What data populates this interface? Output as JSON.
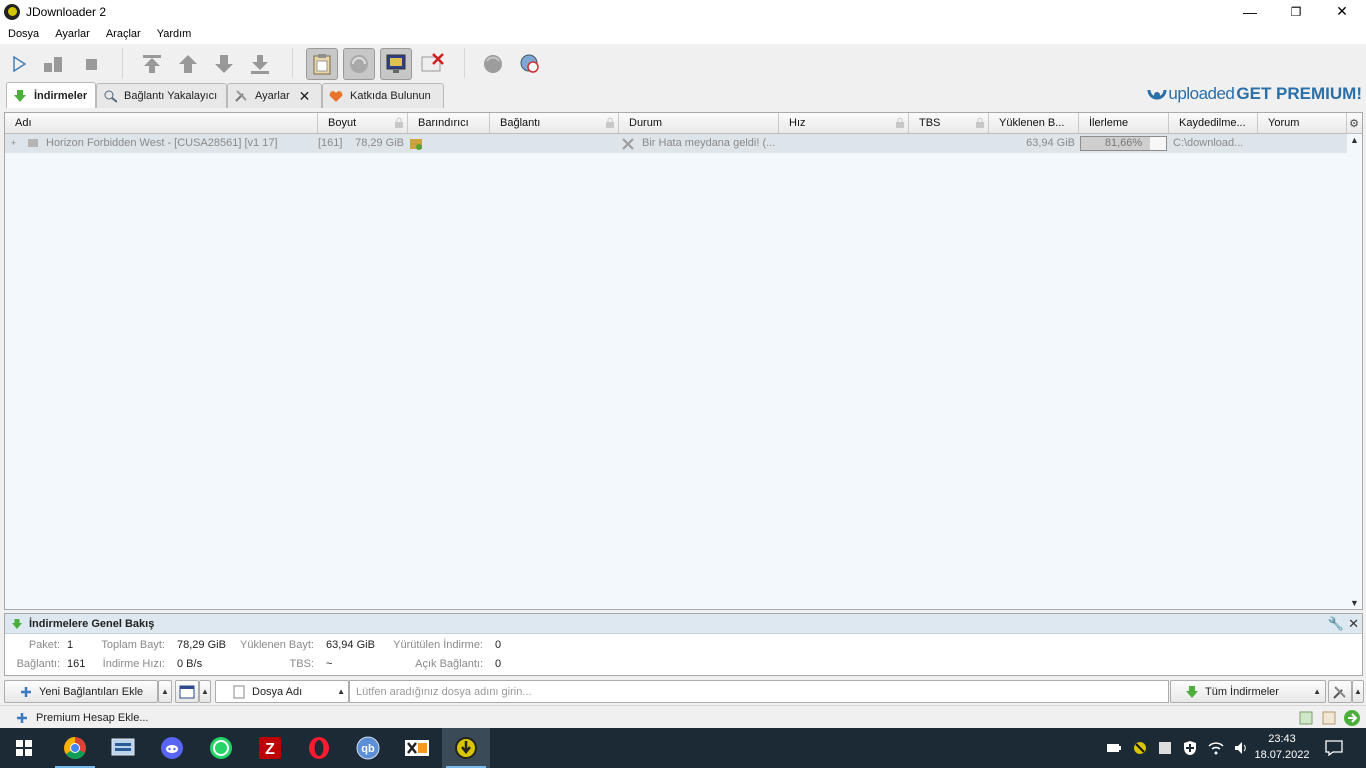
{
  "window": {
    "title": "JDownloader 2",
    "minimize": "—",
    "maximize": "❐",
    "close": "✕"
  },
  "menu": [
    "Dosya",
    "Ayarlar",
    "Araçlar",
    "Yardım"
  ],
  "tabs": [
    {
      "label": "İndirmeler",
      "icon": "download-arrow-icon"
    },
    {
      "label": "Bağlantı Yakalayıcı",
      "icon": "link-grabber-icon"
    },
    {
      "label": "Ayarlar",
      "icon": "tools-icon"
    },
    {
      "label": "Katkıda Bulunun",
      "icon": "heart-icon"
    }
  ],
  "promo": {
    "logo": "uploaded",
    "cta": "GET PREMIUM!"
  },
  "columns": [
    "Adı",
    "Boyut",
    "Barındırıcı",
    "Bağlantı",
    "Durum",
    "Hız",
    "TBS",
    "Yüklenen B...",
    "İlerleme",
    "Kaydedilme...",
    "Yorum"
  ],
  "row": {
    "expander": "+",
    "name": "Horizon Forbidden West - [CUSA28561] [v1 17]",
    "count": "[161]",
    "size": "78,29 GiB",
    "status": "Bir Hata meydana geldi! (...",
    "loaded": "63,94 GiB",
    "progress_text": "81,66%",
    "progress_fraction": 0.8166,
    "saved_to": "C:\\download..."
  },
  "overview": {
    "title": "İndirmelere Genel Bakış",
    "stats": {
      "paket_label": "Paket:",
      "paket": "1",
      "toplam_label": "Toplam Bayt:",
      "toplam": "78,29 GiB",
      "yuklenen_label": "Yüklenen Bayt:",
      "yuklenen": "63,94 GiB",
      "yurutulen_label": "Yürütülen İndirme:",
      "yurutulen": "0",
      "baglanti_label": "Bağlantı:",
      "baglanti": "161",
      "hiz_label": "İndirme Hızı:",
      "hiz": "0 B/s",
      "tbs_label": "TBS:",
      "tbs": "~",
      "acik_label": "Açık Bağlantı:",
      "acik": "0"
    }
  },
  "bottom": {
    "add_links": "Yeni Bağlantıları Ekle",
    "search_field": "Dosya Adı",
    "search_placeholder": "Lütfen aradığınız dosya adını girin...",
    "all_downloads": "Tüm İndirmeler"
  },
  "status": {
    "premium": "Premium Hesap Ekle..."
  },
  "taskbar": {
    "apps": [
      "start-icon",
      "chrome-icon",
      "network-tool-icon",
      "discord-icon",
      "whatsapp-icon",
      "filezilla-icon",
      "opera-icon",
      "qbittorrent-icon",
      "xdm-icon",
      "jdownloader-icon"
    ],
    "qb_label": "qb",
    "time": "23:43",
    "date": "18.07.2022"
  },
  "colors": {
    "accent": "#2a6fa8",
    "table_bg": "#f2f8fc",
    "row_bg": "#dde4ea",
    "taskbar": "#1c2a35"
  }
}
